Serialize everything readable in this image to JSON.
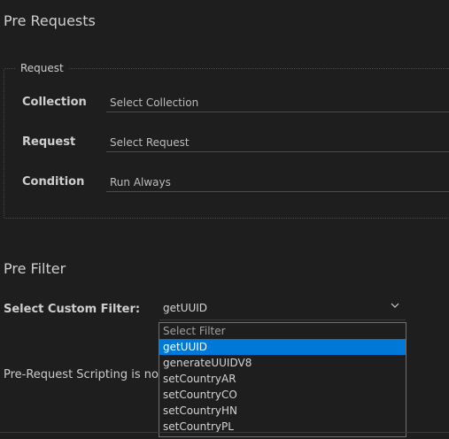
{
  "page": {
    "title": "Pre Requests"
  },
  "request": {
    "legend": "Request",
    "fields": [
      {
        "label": "Collection",
        "value": "Select Collection"
      },
      {
        "label": "Request",
        "value": "Select Request"
      },
      {
        "label": "Condition",
        "value": "Run Always"
      }
    ]
  },
  "pre_filter": {
    "title": "Pre Filter",
    "label": "Select Custom Filter:",
    "selected": "getUUID",
    "chevron": "chevron-down-icon",
    "options": [
      "Select Filter",
      "getUUID",
      "generateUUIDV8",
      "setCountryAR",
      "setCountryCO",
      "setCountryHN",
      "setCountryPL"
    ],
    "selected_index": 1
  },
  "info_text": "Pre-Request Scripting is now",
  "colors": {
    "background": "#1e1e1e",
    "selection": "#0078d7"
  }
}
